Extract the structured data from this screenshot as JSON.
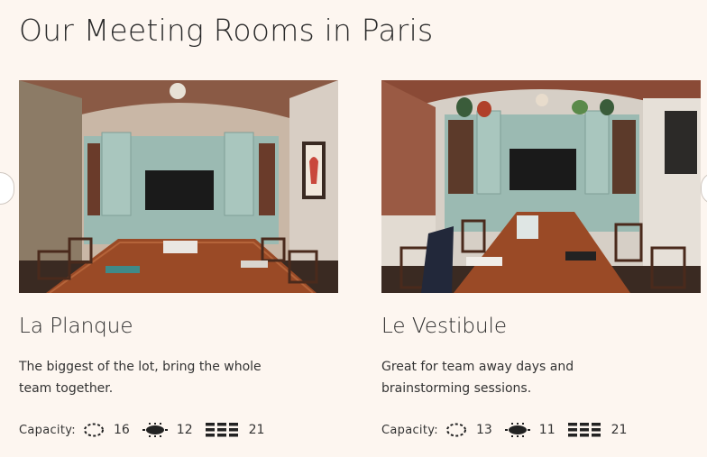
{
  "page": {
    "title": "Our Meeting Rooms in Paris"
  },
  "capacity_label": "Capacity:",
  "icons": {
    "standing": "dashed-circle-icon",
    "boardroom": "boardroom-table-icon",
    "theatre": "theatre-rows-icon"
  },
  "rooms": [
    {
      "name": "La Planque",
      "description": "The biggest of the lot, bring the whole team together.",
      "photo_alt": "Vaulted meeting room with teal cabinets, TV and long wooden table",
      "capacity": {
        "standing": "16",
        "boardroom": "12",
        "theatre": "21"
      }
    },
    {
      "name": "Le Vestibule",
      "description": "Great for team away days and brainstorming sessions.",
      "photo_alt": "Brick vaulted meeting room with teal shelving, TV and wooden table",
      "capacity": {
        "standing": "13",
        "boardroom": "11",
        "theatre": "21"
      }
    }
  ],
  "colors": {
    "background": "#fdf6f0",
    "cabinet": "#9bbab2",
    "table": "#9a4a26"
  }
}
